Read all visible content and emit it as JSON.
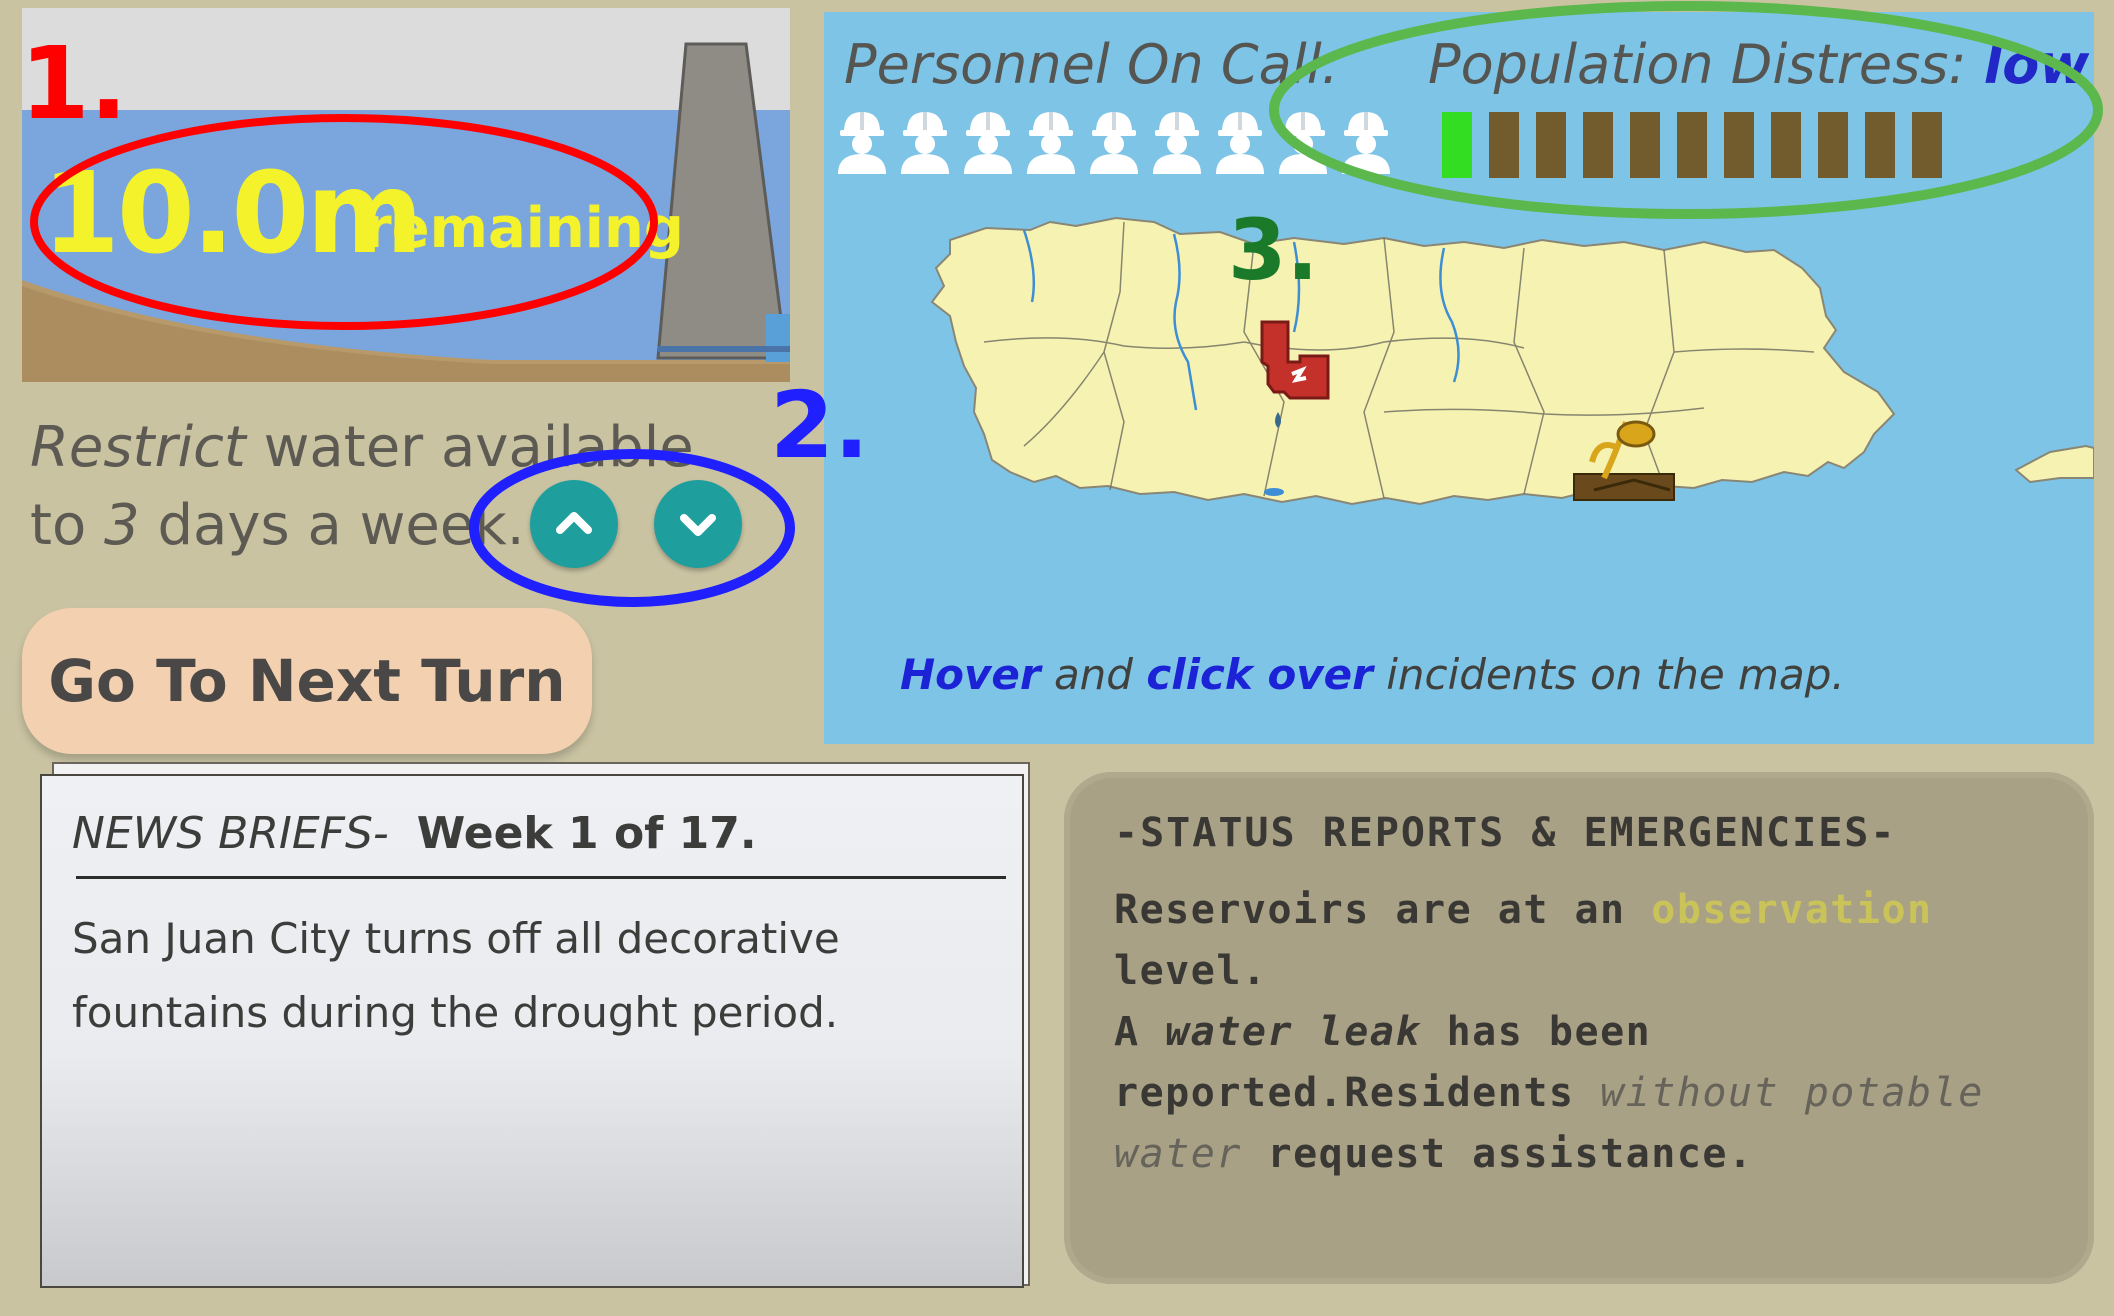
{
  "reservoir": {
    "level_value": "10.0m",
    "level_word": "remaining"
  },
  "restriction": {
    "line1_italic": "Restrict",
    "line1_rest": " water available",
    "line2_pre": "to ",
    "line2_days": "3",
    "line2_post": " days a week."
  },
  "next_turn": {
    "label": "Go To Next Turn"
  },
  "map_panel": {
    "personnel_label": "Personnel On Call:",
    "personnel_count": 9,
    "distress_label": "Population Distress: ",
    "distress_level": "low",
    "distress_segments_total": 11,
    "distress_segments_filled": 1,
    "hint_hover": "Hover",
    "hint_and": " and ",
    "hint_click": "click over",
    "hint_rest": " incidents on the map."
  },
  "news": {
    "heading_italic": "NEWS BRIEFS-",
    "heading_week": "Week 1 of 17.",
    "body": "San Juan City turns off all decorative fountains during the drought period."
  },
  "status": {
    "title": "-STATUS REPORTS & EMERGENCIES-",
    "r1_a": "Reservoirs are at an ",
    "r1_level": "observation",
    "r1_b": "level.",
    "r2_a": "A ",
    "r2_leak": "water leak",
    "r2_b": " has been reported.Residents ",
    "r2_without": "without potable water",
    "r2_c": " request assistance."
  },
  "annotations": {
    "n1": "1.",
    "n2": "2.",
    "n3": "3."
  },
  "colors": {
    "water_blue": "#7ba5dd",
    "map_sea": "#7ec4e7",
    "island": "#f6f2b2",
    "teal_button": "#1f9e9e",
    "distress_green": "#33dd22",
    "distress_brown": "#725c2e",
    "anno_red": "#ff0000",
    "anno_blue": "#2020ff",
    "anno_green": "#5cb84c",
    "anno_darkgreen": "#1a7a2a"
  },
  "icons": [
    "worker-helmet-icon",
    "pipe-leak-icon",
    "wilted-plant-icon",
    "chevron-up-icon",
    "chevron-down-icon"
  ]
}
